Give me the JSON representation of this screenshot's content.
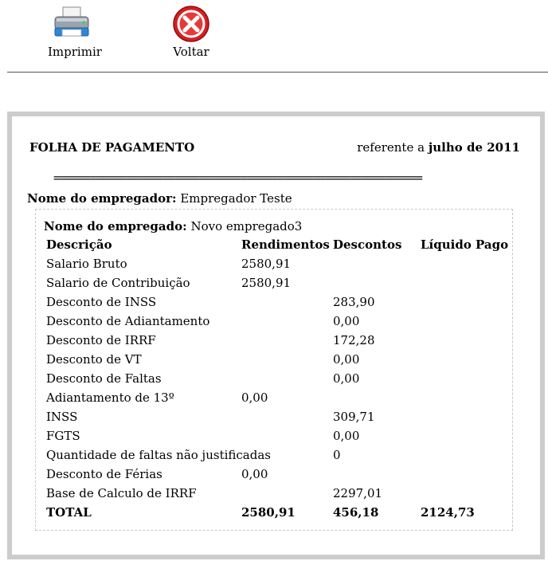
{
  "toolbar": {
    "print_label": "Imprimir",
    "back_label": "Voltar",
    "print_icon": "printer-icon",
    "back_icon": "close-icon"
  },
  "sheet": {
    "title": "FOLHA DE PAGAMENTO",
    "ref_prefix": "referente a",
    "ref_period": "julho de 2011",
    "rule": "=============================================================",
    "employer_label": "Nome do empregador:",
    "employer_value": "Empregador Teste",
    "employee_label": "Nome do empregado:",
    "employee_value": "Novo empregado3"
  },
  "table": {
    "headers": [
      "Descrição",
      "Rendimentos",
      "Descontos",
      "Líquido Pago"
    ],
    "rows": [
      [
        "Salario Bruto",
        "2580,91",
        "",
        ""
      ],
      [
        "Salario de Contribuição",
        "2580,91",
        "",
        ""
      ],
      [
        "Desconto de INSS",
        "",
        "283,90",
        ""
      ],
      [
        "Desconto de Adiantamento",
        "",
        "0,00",
        ""
      ],
      [
        "Desconto de IRRF",
        "",
        "172,28",
        ""
      ],
      [
        "Desconto de VT",
        "",
        "0,00",
        ""
      ],
      [
        "Desconto de Faltas",
        "",
        "0,00",
        ""
      ],
      [
        "Adiantamento de 13º",
        "0,00",
        "",
        ""
      ],
      [
        "INSS",
        "",
        "309,71",
        ""
      ],
      [
        "FGTS",
        "",
        "0,00",
        ""
      ],
      [
        "Quantidade de faltas não justificadas",
        "",
        "0",
        ""
      ],
      [
        "Desconto de Férias",
        "0,00",
        "",
        ""
      ],
      [
        "Base de Calculo de IRRF",
        "",
        "2297,01",
        ""
      ]
    ],
    "total": [
      "TOTAL",
      "2580,91",
      "456,18",
      "2124,73"
    ]
  }
}
